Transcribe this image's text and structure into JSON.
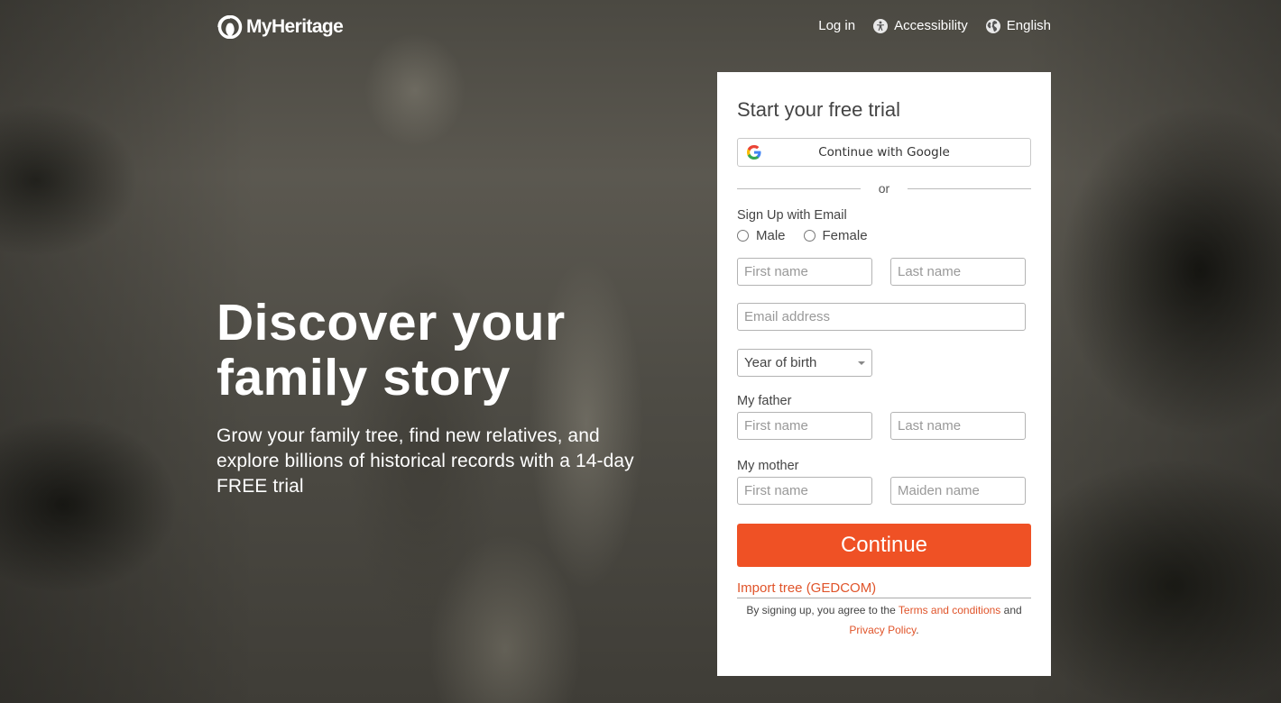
{
  "brand": {
    "name": "MyHeritage",
    "accent_color": "#ef5125",
    "link_color": "#e0542a"
  },
  "nav": {
    "login": "Log in",
    "accessibility": "Accessibility",
    "language": "English"
  },
  "hero": {
    "title_line1": "Discover your",
    "title_line2": "family story",
    "subtitle": "Grow your family tree, find new relatives, and explore billions of historical records with a 14-day FREE trial"
  },
  "signup": {
    "title": "Start your free trial",
    "google_button": "Continue with Google",
    "divider": "or",
    "email_section": "Sign Up with Email",
    "gender_options": [
      "Male",
      "Female"
    ],
    "first_name_placeholder": "First name",
    "last_name_placeholder": "Last name",
    "email_placeholder": "Email address",
    "year_of_birth": "Year of birth",
    "father_label": "My father",
    "father_first_placeholder": "First name",
    "father_last_placeholder": "Last name",
    "mother_label": "My mother",
    "mother_first_placeholder": "First name",
    "mother_maiden_placeholder": "Maiden name",
    "continue_button": "Continue",
    "import_link": "Import tree (GEDCOM)",
    "legal_prefix": "By signing up, you agree to the",
    "terms_link": "Terms and conditions",
    "legal_and": "and",
    "privacy_link": "Privacy Policy",
    "legal_suffix": "."
  }
}
